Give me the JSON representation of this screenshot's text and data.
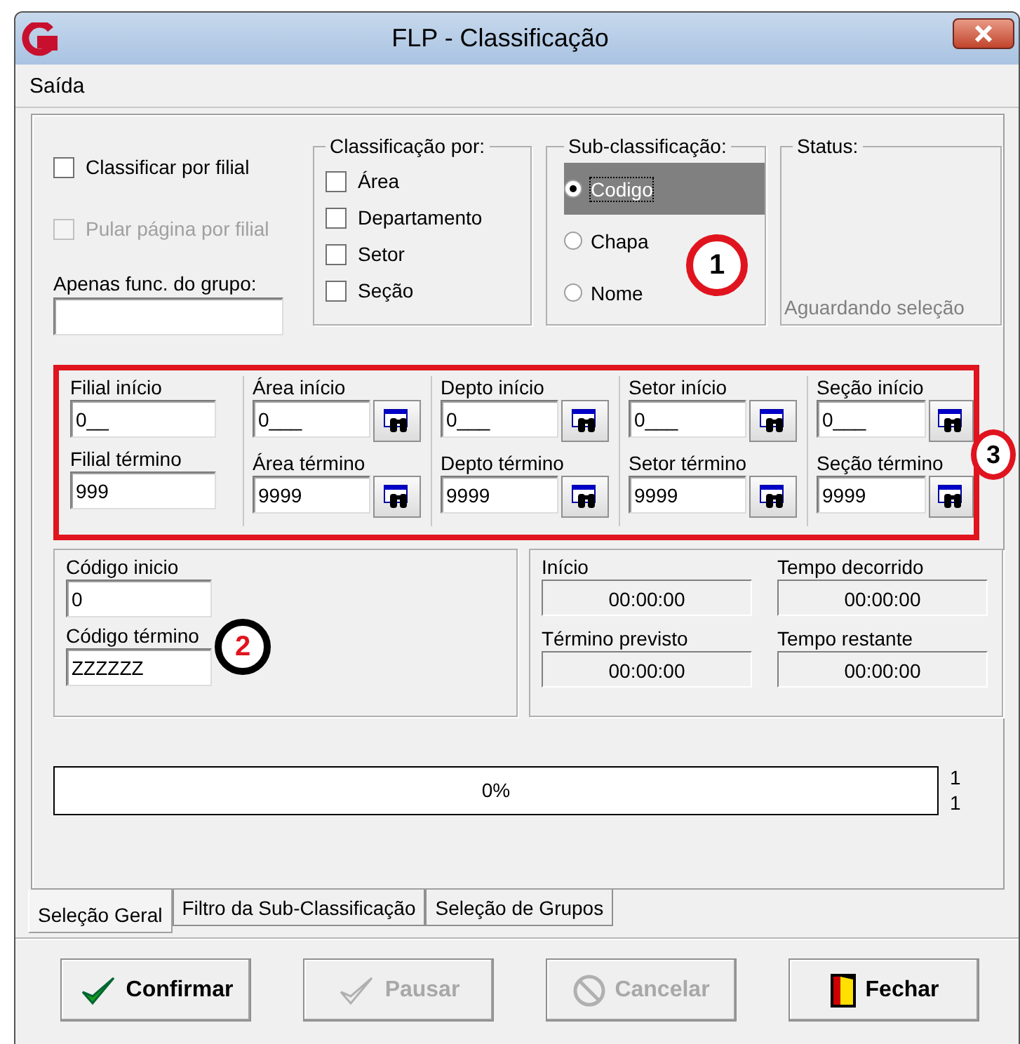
{
  "window": {
    "title": "FLP - Classificação"
  },
  "menu": [
    {
      "label": "Saída"
    }
  ],
  "options": {
    "checkboxes": [
      {
        "label": "Classificar por filial",
        "checked": false,
        "disabled": false
      },
      {
        "label": "Pular página por filial",
        "checked": false,
        "disabled": true
      }
    ],
    "group_label": "Apenas func. do grupo:"
  },
  "classificacao": {
    "title": "Classificação  por:",
    "items": [
      {
        "label": "Área",
        "checked": false
      },
      {
        "label": "Departamento",
        "checked": false
      },
      {
        "label": "Setor",
        "checked": false
      },
      {
        "label": "Seção",
        "checked": false
      }
    ]
  },
  "sub_classificacao": {
    "title": "Sub-classificação:",
    "items": [
      {
        "label": "Codigo",
        "selected": true
      },
      {
        "label": "Chapa",
        "selected": false
      },
      {
        "label": "Nome",
        "selected": false
      }
    ]
  },
  "status": {
    "title": "Status:",
    "text": "Aguardando seleção"
  },
  "ranges": [
    {
      "start_label": "Filial início",
      "start_value": "0__",
      "end_label": "Filial término",
      "end_value": "999",
      "lookup": false
    },
    {
      "start_label": "Área início",
      "start_value": "0___",
      "end_label": "Área término",
      "end_value": "9999",
      "lookup": true
    },
    {
      "start_label": "Depto início",
      "start_value": "0___",
      "end_label": "Depto término",
      "end_value": "9999",
      "lookup": true
    },
    {
      "start_label": "Setor início",
      "start_value": "0___",
      "end_label": "Setor término",
      "end_value": "9999",
      "lookup": true
    },
    {
      "start_label": "Seção início",
      "start_value": "0___",
      "end_label": "Seção término",
      "end_value": "9999",
      "lookup": true
    }
  ],
  "codigo": {
    "start_label": "Código inicio",
    "start_value": "0",
    "end_label": "Código término",
    "end_value": "ZZZZZZ"
  },
  "timers": [
    {
      "caption": "Início",
      "time": "00:00:00"
    },
    {
      "caption": "Tempo decorrido",
      "time": "00:00:00"
    },
    {
      "caption": "Término previsto",
      "time": "00:00:00"
    },
    {
      "caption": "Tempo restante",
      "time": "00:00:00"
    }
  ],
  "progress": {
    "level": 0,
    "text": "0%"
  },
  "counters": [
    "1",
    "1"
  ],
  "tabs": [
    {
      "label": "Seleção Geral",
      "selected": true
    },
    {
      "label": "Filtro da Sub-Classificação",
      "selected": false
    },
    {
      "label": "Seleção de Grupos",
      "selected": false
    }
  ],
  "buttons": [
    {
      "label": "Confirmar",
      "kind": "check",
      "disabled": false
    },
    {
      "label": "Pausar",
      "kind": "check",
      "disabled": true
    },
    {
      "label": "Cancelar",
      "kind": "cancel",
      "disabled": true
    },
    {
      "label": "Fechar",
      "kind": "door",
      "disabled": false
    }
  ],
  "callouts": [
    {
      "number": "1"
    },
    {
      "number": "2"
    },
    {
      "number": "3"
    }
  ]
}
